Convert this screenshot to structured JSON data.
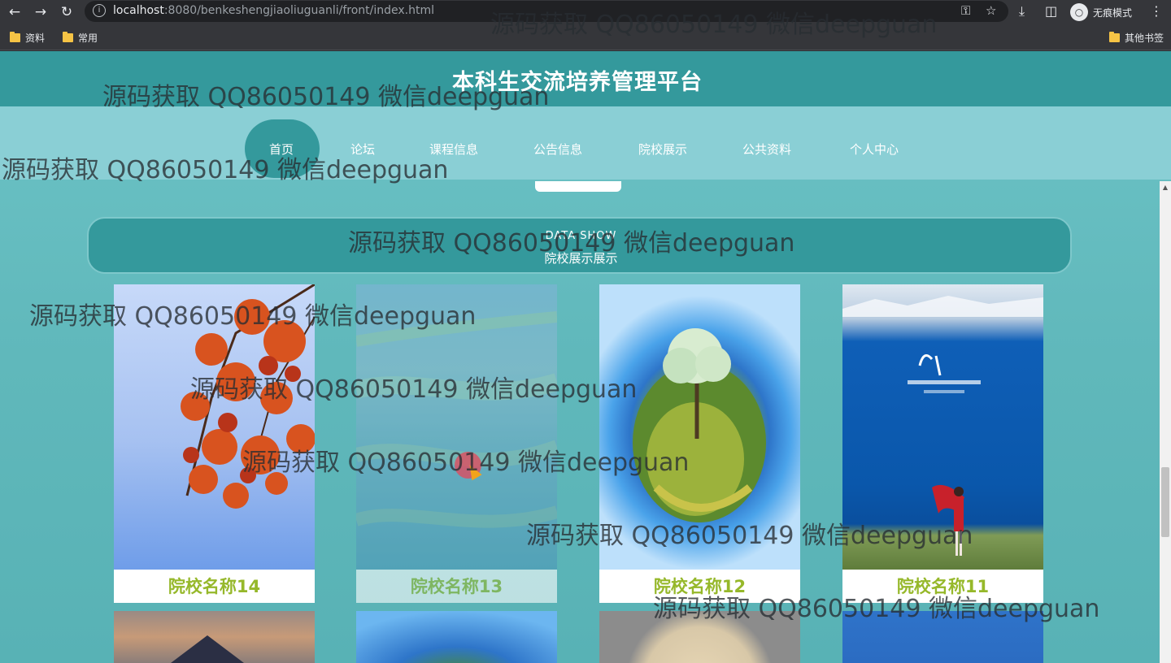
{
  "browser": {
    "url_host": "localhost",
    "url_rest": ":8080/benkeshengjiaoliuguanli/front/index.html",
    "incognito_label": "无痕模式",
    "bookmarks": [
      {
        "label": "资料"
      },
      {
        "label": "常用"
      },
      {
        "label": "其他书签"
      }
    ]
  },
  "site": {
    "title": "本科生交流培养管理平台",
    "nav": [
      {
        "label": "首页",
        "active": true
      },
      {
        "label": "论坛"
      },
      {
        "label": "课程信息"
      },
      {
        "label": "公告信息"
      },
      {
        "label": "院校展示"
      },
      {
        "label": "公共资料"
      },
      {
        "label": "个人中心"
      }
    ]
  },
  "section": {
    "title_en": "DATA SHOW",
    "title_cn": "院校展示展示"
  },
  "cards": [
    {
      "name": "院校名称14"
    },
    {
      "name": "院校名称13"
    },
    {
      "name": "院校名称12"
    },
    {
      "name": "院校名称11"
    }
  ],
  "watermark": "源码获取 QQ86050149 微信deepguan",
  "colors": {
    "header": "#34999c",
    "nav_strip": "#8acfd5",
    "card_name": "#96b82a"
  }
}
